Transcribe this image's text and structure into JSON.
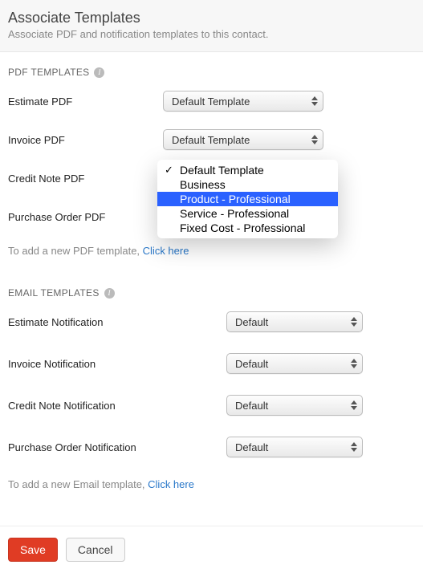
{
  "header": {
    "title": "Associate Templates",
    "subtitle": "Associate PDF and notification templates to this contact."
  },
  "pdf": {
    "section_title": "PDF TEMPLATES",
    "rows": {
      "estimate": {
        "label": "Estimate PDF",
        "value": "Default Template"
      },
      "invoice": {
        "label": "Invoice PDF",
        "value": "Default Template"
      },
      "credit_note": {
        "label": "Credit Note PDF",
        "value": ""
      },
      "purchase_order": {
        "label": "Purchase Order PDF",
        "value": ""
      }
    },
    "dropdown_options": [
      "Default Template",
      "Business",
      "Product - Professional",
      "Service - Professional",
      "Fixed Cost - Professional"
    ],
    "dropdown_selected_index": 0,
    "dropdown_highlight_index": 2,
    "add_text_prefix": "To add a new PDF template, ",
    "add_link": "Click here"
  },
  "email": {
    "section_title": "EMAIL TEMPLATES",
    "rows": {
      "estimate": {
        "label": "Estimate Notification",
        "value": "Default"
      },
      "invoice": {
        "label": "Invoice Notification",
        "value": "Default"
      },
      "credit_note": {
        "label": "Credit Note Notification",
        "value": "Default"
      },
      "purchase_order": {
        "label": "Purchase Order Notification",
        "value": "Default"
      }
    },
    "add_text_prefix": "To add a new Email template, ",
    "add_link": "Click here"
  },
  "footer": {
    "save": "Save",
    "cancel": "Cancel"
  }
}
